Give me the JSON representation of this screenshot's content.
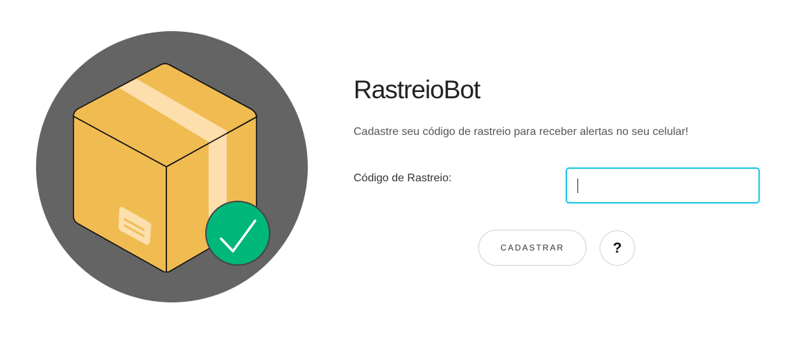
{
  "app": {
    "title": "RastreioBot",
    "subtitle": "Cadastre seu código de rastreio para receber alertas no seu celular!"
  },
  "illustration": {
    "icon": "package-box-with-check-icon",
    "colors": {
      "circle": "#646464",
      "box": "#f0bc52",
      "tape": "#fddfae",
      "check": "#00b77a"
    }
  },
  "form": {
    "tracking_label": "Código de Rastreio:",
    "tracking_value": "",
    "tracking_placeholder": "",
    "accent_color": "#1cc9e3",
    "register_label": "CADASTRAR",
    "help_label": "?"
  }
}
